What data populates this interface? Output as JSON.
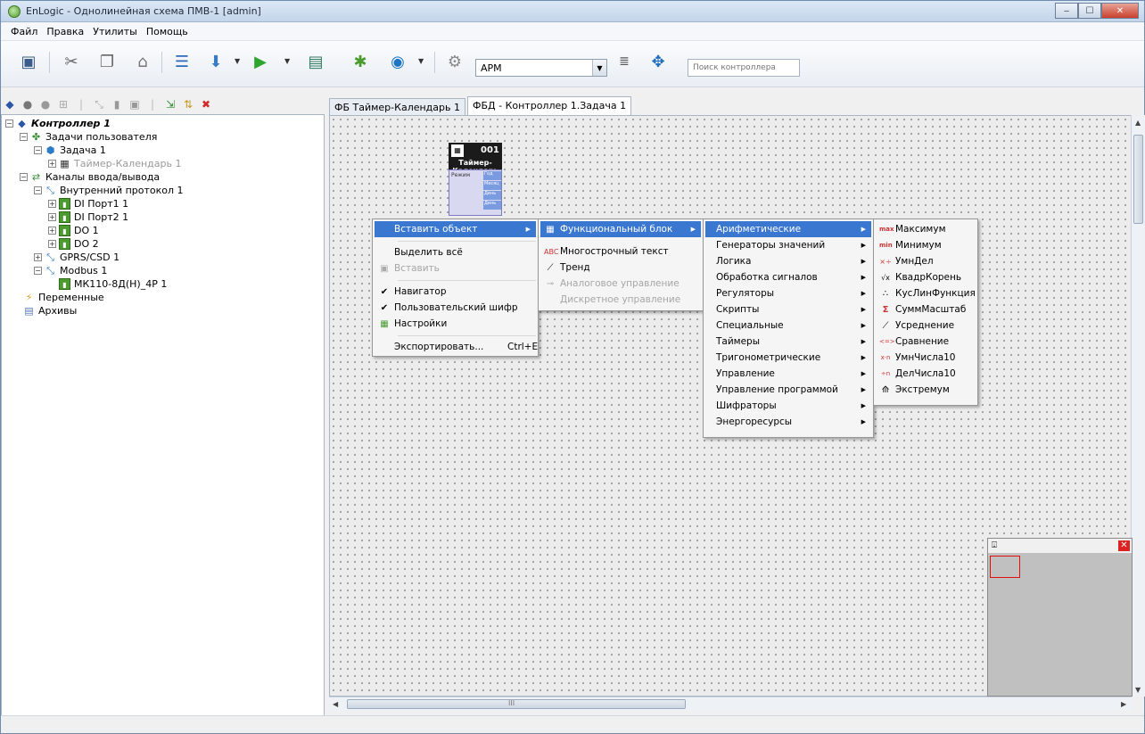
{
  "window": {
    "title": "EnLogic - Однолинейная схема ПМВ-1 [admin]",
    "minimize": "‒",
    "maximize": "☐",
    "close": "✕"
  },
  "menubar": [
    "Файл",
    "Правка",
    "Утилиты",
    "Помощь"
  ],
  "toolbar": {
    "mode_select": "АРМ",
    "search_placeholder": "Поиск контроллера"
  },
  "tree": {
    "controller": "Контроллер 1",
    "user_tasks": "Задачи пользователя",
    "task1": "Задача 1",
    "timer_calendar": "Таймер-Календарь 1",
    "io_channels": "Каналы ввода/вывода",
    "internal_protocol": "Внутренний протокол 1",
    "di_port1": "DI Порт1 1",
    "di_port2": "DI Порт2 1",
    "do1": "DO 1",
    "do2": "DO 2",
    "gprs": "GPRS/CSD 1",
    "modbus": "Modbus 1",
    "mk110": "МК110-8Д(Н)_4Р 1",
    "variables": "Переменные",
    "archives": "Архивы"
  },
  "tabs": [
    {
      "label": "ФБ Таймер-Календарь 1",
      "active": false
    },
    {
      "label": "ФБД - Контроллер 1.Задача 1",
      "active": true
    }
  ],
  "fb_block": {
    "number": "001",
    "name": "Таймер-Календарь",
    "input": "Режим",
    "outputs": [
      "Год",
      "Месяц",
      "День",
      "День"
    ]
  },
  "context_menu": {
    "insert_object": "Вставить объект",
    "select_all": "Выделить всё",
    "paste": "Вставить",
    "navigator": "Навигатор",
    "user_encoder": "Пользовательский шифр",
    "settings": "Настройки",
    "export": "Экспортировать...",
    "export_shortcut": "Ctrl+E"
  },
  "insert_submenu": {
    "function_block": "Функциональный блок",
    "multiline_text": "Многострочный текст",
    "trend": "Тренд",
    "analog_control": "Аналоговое управление",
    "discrete_control": "Дискретное управление"
  },
  "category_submenu": [
    "Арифметические",
    "Генераторы значений",
    "Логика",
    "Обработка сигналов",
    "Регуляторы",
    "Скрипты",
    "Специальные",
    "Таймеры",
    "Тригонометрические",
    "Управление",
    "Управление программой",
    "Шифраторы",
    "Энергоресурсы"
  ],
  "arithmetic_submenu": [
    {
      "icon": "max",
      "label": "Максимум"
    },
    {
      "icon": "min",
      "label": "Минимум"
    },
    {
      "icon": "×÷",
      "label": "УмнДел"
    },
    {
      "icon": "√x",
      "label": "КвадрКорень"
    },
    {
      "icon": "∴",
      "label": "КусЛинФункция"
    },
    {
      "icon": "Σ",
      "label": "СуммМасштаб"
    },
    {
      "icon": "⟋",
      "label": "Усреднение"
    },
    {
      "icon": "<=>",
      "label": "Сравнение"
    },
    {
      "icon": "x·n",
      "label": "УмнЧисла10"
    },
    {
      "icon": "÷n",
      "label": "ДелЧисла10"
    },
    {
      "icon": "⟰",
      "label": "Экстремум"
    }
  ],
  "hscroll_center": "III"
}
